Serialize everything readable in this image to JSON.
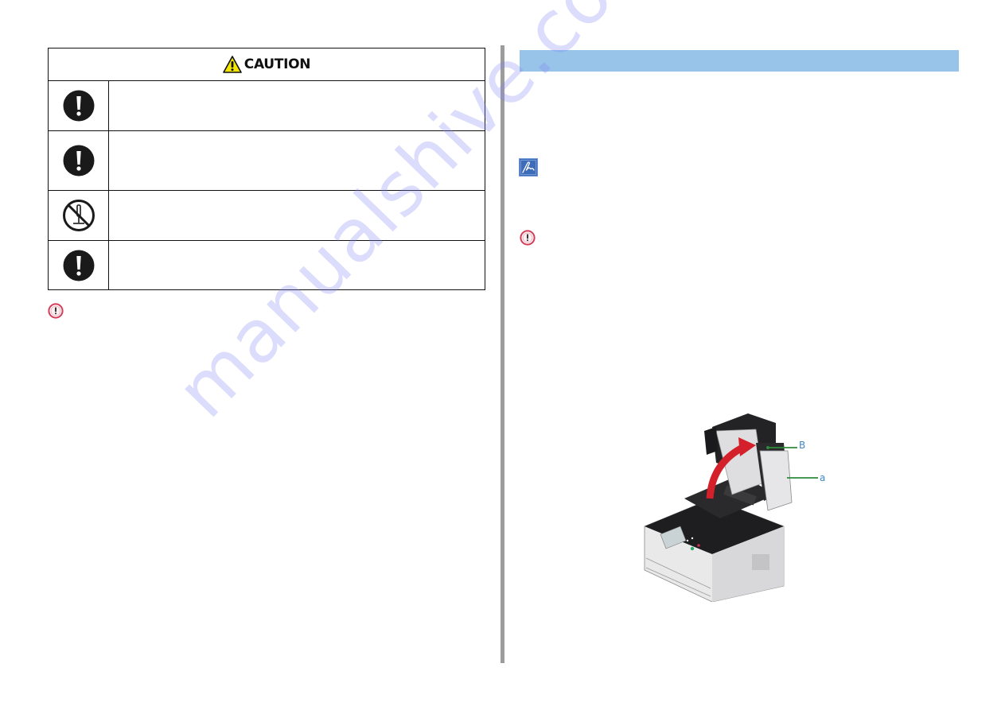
{
  "caution_table": {
    "header_label": "CAUTION",
    "header_icon": "warning-triangle-icon",
    "rows": [
      {
        "icon": "mandatory-exclamation-icon",
        "text": ""
      },
      {
        "icon": "mandatory-exclamation-icon",
        "text": ""
      },
      {
        "icon": "no-disassembly-icon",
        "text": ""
      },
      {
        "icon": "mandatory-exclamation-icon",
        "text": ""
      }
    ]
  },
  "left_column": {
    "important_icon": "important-icon",
    "important_text": ""
  },
  "right_column": {
    "section_title": "",
    "note_icon": "memo-icon",
    "note_text": "",
    "important_icon": "important-icon",
    "important_text": ""
  },
  "illustration": {
    "subject": "printer with scanner unit lifted open",
    "callouts": [
      {
        "label": "B"
      },
      {
        "label": "a"
      }
    ]
  },
  "colors": {
    "section_bar": "#98c4ea",
    "divider": "#9c9c9c",
    "important_ring": "#d43c5a",
    "note_bg": "#3d6cb9",
    "callout_text": "#3f86c8",
    "callout_line": "#2e8b3a",
    "arrow": "#d4202a",
    "warning_yellow": "#f2e600"
  },
  "watermark": "manualshive.com"
}
